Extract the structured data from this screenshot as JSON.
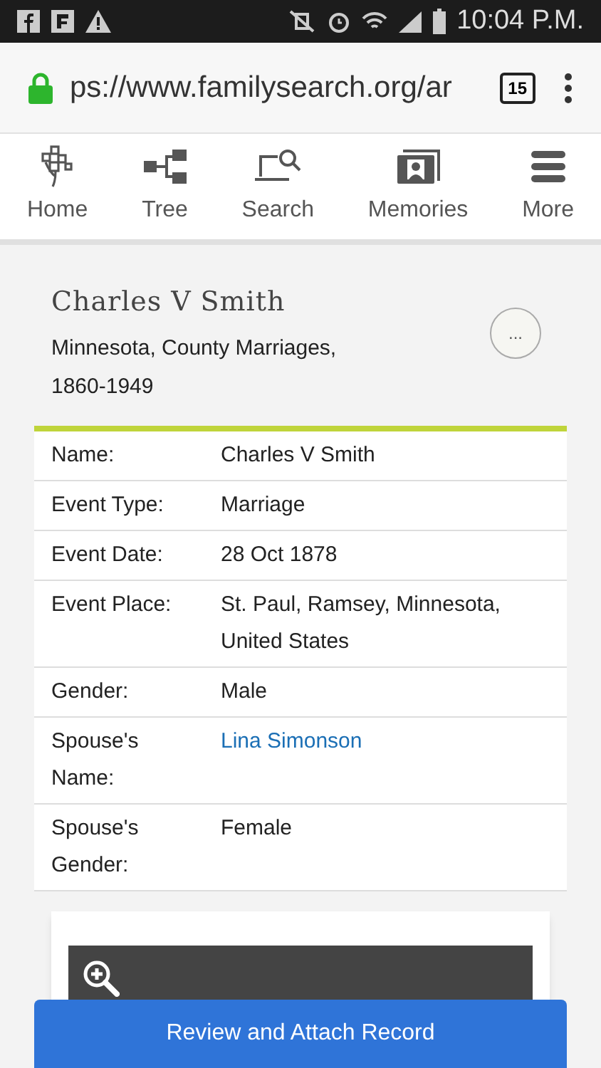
{
  "status_bar": {
    "time": "10:04 P.M."
  },
  "address_bar": {
    "url": "ps://www.familysearch.org/ar",
    "tab_count": "15"
  },
  "nav": [
    {
      "label": "Home",
      "kind": "home"
    },
    {
      "label": "Tree",
      "kind": "tree"
    },
    {
      "label": "Search",
      "kind": "search"
    },
    {
      "label": "Memories",
      "kind": "memories"
    },
    {
      "label": "More",
      "kind": "more"
    }
  ],
  "record": {
    "name": "Charles V Smith",
    "collection": "Minnesota, County Marriages, 1860-1949",
    "menu_label": "...",
    "rows": [
      {
        "label": "Name:",
        "value": "Charles V Smith",
        "kind": "text"
      },
      {
        "label": "Event Type:",
        "value": "Marriage",
        "kind": "text"
      },
      {
        "label": "Event Date:",
        "value": "28 Oct 1878",
        "kind": "text"
      },
      {
        "label": "Event Place:",
        "value": "St. Paul, Ramsey, Minnesota, United States",
        "kind": "text"
      },
      {
        "label": "Gender:",
        "value": "Male",
        "kind": "text"
      },
      {
        "label": "Spouse's Name:",
        "value": "Lina Simonson",
        "kind": "link"
      },
      {
        "label": "Spouse's Gender:",
        "value": "Female",
        "kind": "text"
      }
    ]
  },
  "action_button": "Review and Attach Record"
}
